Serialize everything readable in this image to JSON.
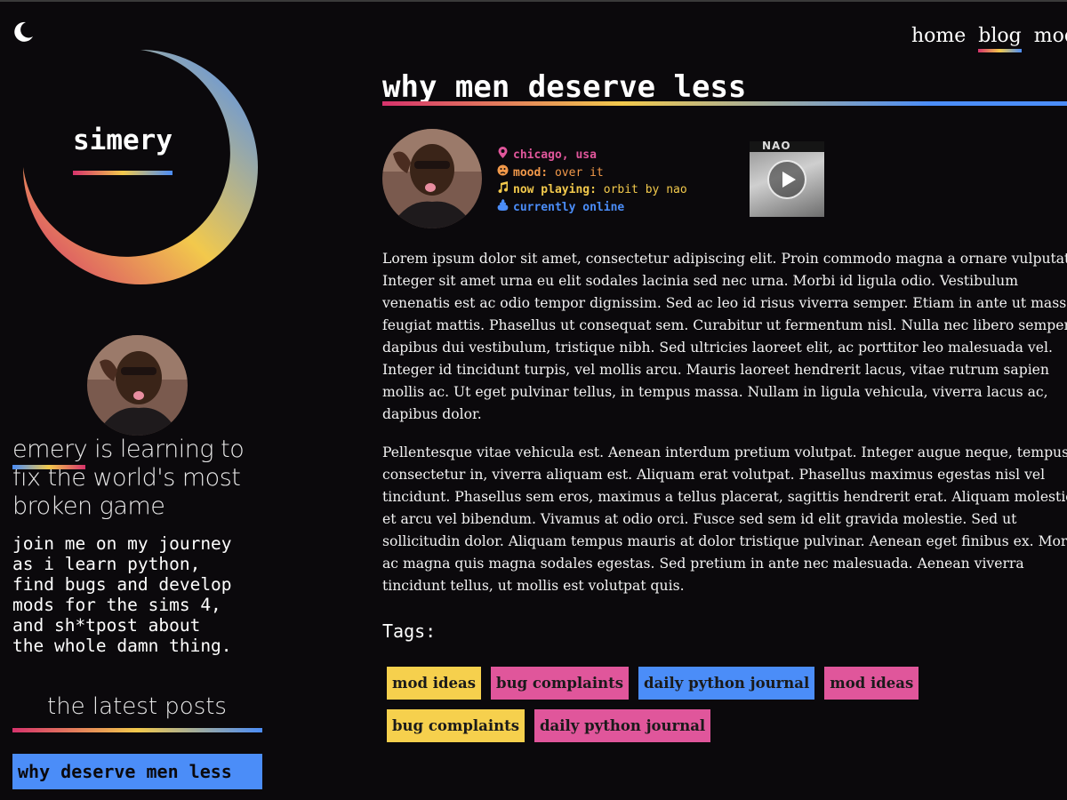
{
  "site": {
    "logo_text": "simery",
    "theme_toggle_icon": "moon-icon"
  },
  "nav": {
    "items": [
      {
        "label": "home",
        "active": false
      },
      {
        "label": "blog",
        "active": true
      },
      {
        "label": "mods",
        "active": false
      }
    ]
  },
  "sidebar": {
    "tagline": "emery is learning to fix the world's most broken game",
    "intro": "join me on my journey\nas i learn python,\nfind bugs and develop\nmods for the sims 4,\nand sh*tpost about\nthe whole damn thing.",
    "latest_title": "the latest posts",
    "latest_posts": [
      "why deserve men less"
    ]
  },
  "post": {
    "title": "why men deserve less",
    "meta": {
      "location": "chicago, usa",
      "mood_label": "mood:",
      "mood_value": "over it",
      "playing_label": "now playing:",
      "playing_value": "orbit by nao",
      "status": "currently online"
    },
    "album_text": "NAO",
    "paragraphs": [
      "Lorem ipsum dolor sit amet, consectetur adipiscing elit. Proin commodo magna a ornare vulputate. Integer sit amet urna eu elit sodales lacinia sed nec urna. Morbi id ligula odio. Vestibulum venenatis est ac odio tempor dignissim. Sed ac leo id risus viverra semper. Etiam in ante ut massa feugiat mattis. Phasellus ut consequat sem. Curabitur ut fermentum nisl. Nulla nec libero semper, dapibus dui vestibulum, tristique nibh. Sed ultricies laoreet elit, ac porttitor leo malesuada vel. Integer id tincidunt turpis, vel mollis arcu. Mauris laoreet hendrerit lacus, vitae rutrum sapien mollis ac. Ut eget pulvinar tellus, in tempus massa. Nullam in ligula vehicula, viverra lacus ac, dapibus dolor.",
      "Pellentesque vitae vehicula est. Aenean interdum pretium volutpat. Integer augue neque, tempus a consectetur in, viverra aliquam est. Aliquam erat volutpat. Phasellus maximus egestas nisl vel tincidunt. Phasellus sem eros, maximus a tellus placerat, sagittis hendrerit erat. Aliquam molestie et arcu vel bibendum. Vivamus at odio orci. Fusce sed sem id elit gravida molestie. Sed ut sollicitudin dolor. Aliquam tempus mauris at dolor tristique pulvinar. Aenean eget finibus ex. Morbi ac magna quis magna sodales egestas. Sed pretium in ante nec malesuada. Aenean viverra tincidunt tellus, ut mollis est volutpat quis."
    ],
    "tags_label": "Tags:",
    "tags": [
      {
        "label": "mod ideas",
        "color": "#f6d04d"
      },
      {
        "label": "bug complaints",
        "color": "#e0569b"
      },
      {
        "label": "daily python journal",
        "color": "#4b8df8"
      },
      {
        "label": "mod ideas",
        "color": "#e0569b"
      },
      {
        "label": "bug complaints",
        "color": "#f6d04d"
      },
      {
        "label": "daily python journal",
        "color": "#e0569b"
      }
    ]
  },
  "colors": {
    "background": "#0b090c",
    "pink": "#e0569b",
    "yellow": "#f6d04d",
    "blue": "#4b8df8",
    "orange": "#f2994a"
  }
}
